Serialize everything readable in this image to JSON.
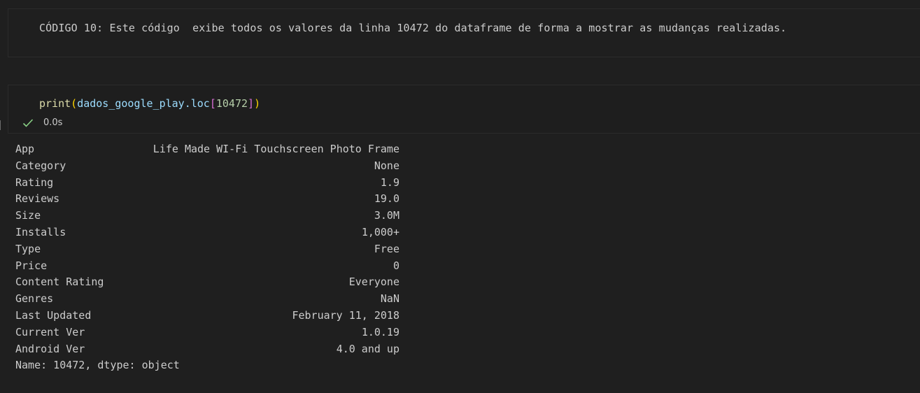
{
  "markdown_cell": {
    "text": "CÓDIGO 10: Este código  exibe todos os valores da linha 10472 do dataframe de forma a mostrar as mudanças realizadas."
  },
  "code_cell": {
    "fn": "print",
    "open_paren": "(",
    "var": "dados_google_play",
    "attr": ".loc",
    "open_bracket": "[",
    "index": "10472",
    "close_bracket": "]",
    "close_paren": ")",
    "status_icon": "check-icon",
    "exec_time": "0.0s"
  },
  "output": {
    "rows": [
      {
        "key": "App",
        "value": "Life Made WI-Fi Touchscreen Photo Frame"
      },
      {
        "key": "Category",
        "value": "None"
      },
      {
        "key": "Rating",
        "value": "1.9"
      },
      {
        "key": "Reviews",
        "value": "19.0"
      },
      {
        "key": "Size",
        "value": "3.0M"
      },
      {
        "key": "Installs",
        "value": "1,000+"
      },
      {
        "key": "Type",
        "value": "Free"
      },
      {
        "key": "Price",
        "value": "0"
      },
      {
        "key": "Content Rating",
        "value": "Everyone"
      },
      {
        "key": "Genres",
        "value": "NaN"
      },
      {
        "key": "Last Updated",
        "value": "February 11, 2018"
      },
      {
        "key": "Current Ver",
        "value": "1.0.19"
      },
      {
        "key": "Android Ver",
        "value": "4.0 and up"
      }
    ],
    "footer": "Name: 10472, dtype: object"
  },
  "colors": {
    "background": "#1f1f1f",
    "text": "#cccccc",
    "success": "#89d185"
  }
}
